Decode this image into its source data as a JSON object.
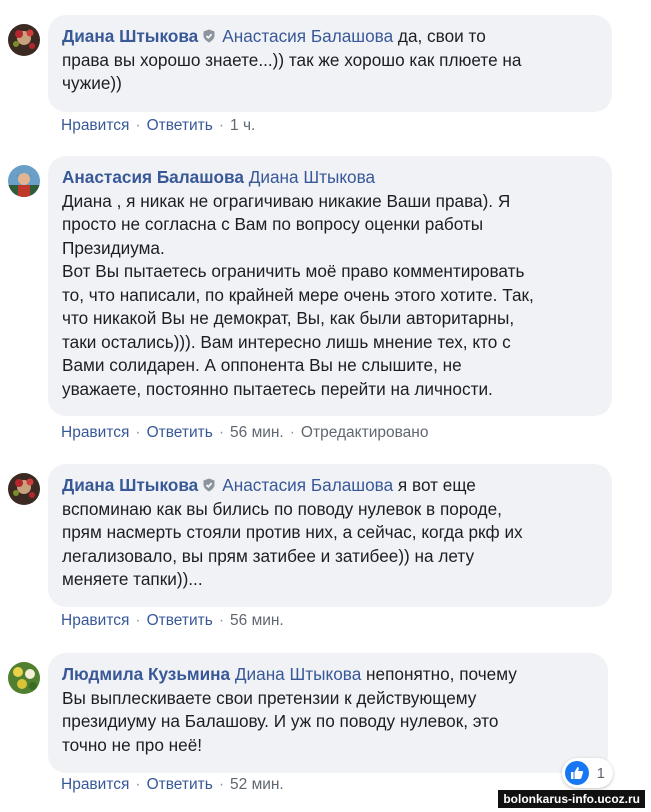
{
  "comments": [
    {
      "author": "Диана Штыкова",
      "has_badge": true,
      "reply_to": "Анастасия Балашова",
      "text": "да, свои то\nправа вы хорошо знаете...)) так же хорошо как плюете на\nчужие))",
      "actions": {
        "like": "Нравится",
        "reply": "Ответить",
        "time": "1 ч."
      }
    },
    {
      "author": "Анастасия Балашова",
      "has_badge": false,
      "reply_to": "Диана Штыкова",
      "text": "Диана , я никак не ограгичиваю никакие Ваши права). Я\nпросто не согласна с Вам по вопросу оценки работы\nПрезидиума.\nВот Вы пытаетесь ограничить моё право комментировать\nто, что написали, по крайней мере очень этого хотите. Так,\nчто никакой Вы не демократ, Вы, как были авторитарны,\nтаки остались))). Вам интересно лишь мнение тех, кто с\nВами солидарен. А оппонента Вы не слышите, не\nуважаете, постоянно пытаетесь перейти на личности.",
      "actions": {
        "like": "Нравится",
        "reply": "Ответить",
        "time": "56 мин.",
        "edited": "Отредактировано"
      }
    },
    {
      "author": "Диана Штыкова",
      "has_badge": true,
      "reply_to": "Анастасия Балашова",
      "text": "я вот еще\nвспоминаю как вы бились по поводу нулевок в породе,\nпрям насмерть стояли против них, а сейчас, когда ркф их\nлегализовало, вы прям затибее и затибее)) на лету\nменяете тапки))...",
      "actions": {
        "like": "Нравится",
        "reply": "Ответить",
        "time": "56 мин."
      }
    },
    {
      "author": "Людмила Кузьмина",
      "has_badge": false,
      "reply_to": "Диана Штыкова",
      "text": "непонятно, почему\nВы выплескиваете свои претензии к действующему\nпрезидиуму на Балашову. И уж по поводу нулевок, это\nточно не про неё!",
      "actions": {
        "like": "Нравится",
        "reply": "Ответить",
        "time": "52 мин."
      }
    }
  ],
  "reactions": {
    "count": "1",
    "icon": "like-icon",
    "color": "#1877f2"
  },
  "watermark": "bolonkarus-info.ucoz.ru",
  "colors": {
    "link": "#385898",
    "bubble": "#f0f2f5",
    "meta": "#606770"
  }
}
